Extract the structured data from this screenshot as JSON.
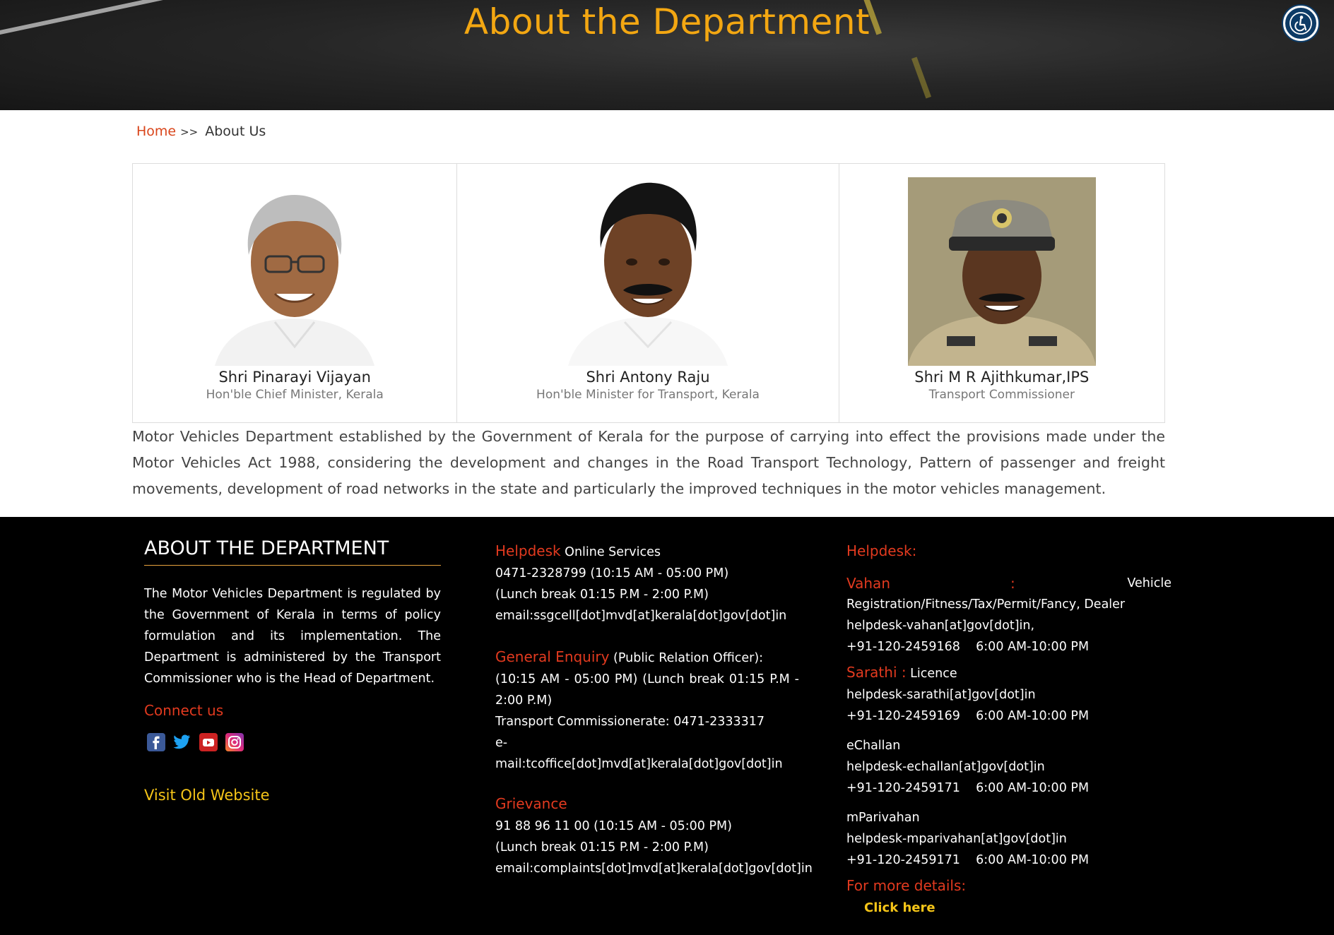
{
  "hero": {
    "title": "About the Department"
  },
  "breadcrumb": {
    "home": "Home",
    "separator": ">>",
    "current": "About Us"
  },
  "profiles": [
    {
      "name": "Shri Pinarayi Vijayan",
      "role": "Hon'ble Chief Minister, Kerala"
    },
    {
      "name": "Shri Antony Raju",
      "role": "Hon'ble Minister for Transport, Kerala"
    },
    {
      "name": "Shri M R Ajithkumar,IPS",
      "role": "Transport Commissioner"
    }
  ],
  "intro": "Motor Vehicles Department established by the Government of Kerala for the purpose of carrying into effect the provisions made under the Motor Vehicles Act 1988, considering the development and changes in the Road Transport Technology, Pattern of passenger and freight movements, development of road networks in the state and particularly the improved techniques in the motor vehicles management.",
  "footer": {
    "about": {
      "title": "ABOUT THE DEPARTMENT",
      "text": "The Motor Vehicles Department is regulated by the Government of Kerala in terms of policy formulation and its implementation. The Department is administered by the Transport Commissioner who is the Head of Department.",
      "connect": "Connect us",
      "social": [
        "facebook-icon",
        "twitter-icon",
        "youtube-icon",
        "instagram-icon"
      ],
      "old_site": "Visit Old Website"
    },
    "helpdesk_online": {
      "label": "Helpdesk",
      "label_rest": " Online Services",
      "phone": "0471-2328799 (10:15 AM - 05:00 PM)",
      "lunch": "(Lunch break 01:15 P.M - 2:00 P.M)",
      "email": "email:ssgcell[dot]mvd[at]kerala[dot]gov[dot]in"
    },
    "general_enquiry": {
      "label": "General Enquiry",
      "label_rest": " (Public Relation Officer):",
      "hours": "(10:15 AM - 05:00 PM) (Lunch break 01:15 P.M - 2:00 P.M)",
      "phone": "Transport Commissionerate: 0471-2333317",
      "email_prefix": "e-",
      "email": "mail:tcoffice[dot]mvd[at]kerala[dot]gov[dot]in"
    },
    "grievance": {
      "label": "Grievance",
      "phone": "91 88 96 11 00 (10:15 AM - 05:00 PM)",
      "lunch": "(Lunch break 01:15 P.M - 2:00 P.M)",
      "email": "email:complaints[dot]mvd[at]kerala[dot]gov[dot]in"
    },
    "helpdesk": {
      "title": "Helpdesk:",
      "vahan_label": "Vahan",
      "vahan_colon": ":",
      "vahan_first": "Vehicle",
      "vahan_desc": "Registration/Fitness/Tax/Permit/Fancy, Dealer",
      "vahan_email": "helpdesk-vahan[at]gov[dot]in,",
      "vahan_phone": "+91-120-2459168    6:00 AM-10:00 PM",
      "sarathi_label": "Sarathi :",
      "sarathi_desc": " Licence",
      "sarathi_email": "helpdesk-sarathi[at]gov[dot]in",
      "sarathi_phone": "+91-120-2459169    6:00 AM-10:00 PM",
      "echallan_label": "eChallan",
      "echallan_email": "helpdesk-echallan[at]gov[dot]in",
      "echallan_phone": "+91-120-2459171    6:00 AM-10:00 PM",
      "mparivahan_label": "mParivahan",
      "mparivahan_email": "helpdesk-mparivahan[at]gov[dot]in",
      "mparivahan_phone": "+91-120-2459171    6:00 AM-10:00 PM",
      "more_label": "For more details:",
      "click_here": "Click here"
    }
  }
}
